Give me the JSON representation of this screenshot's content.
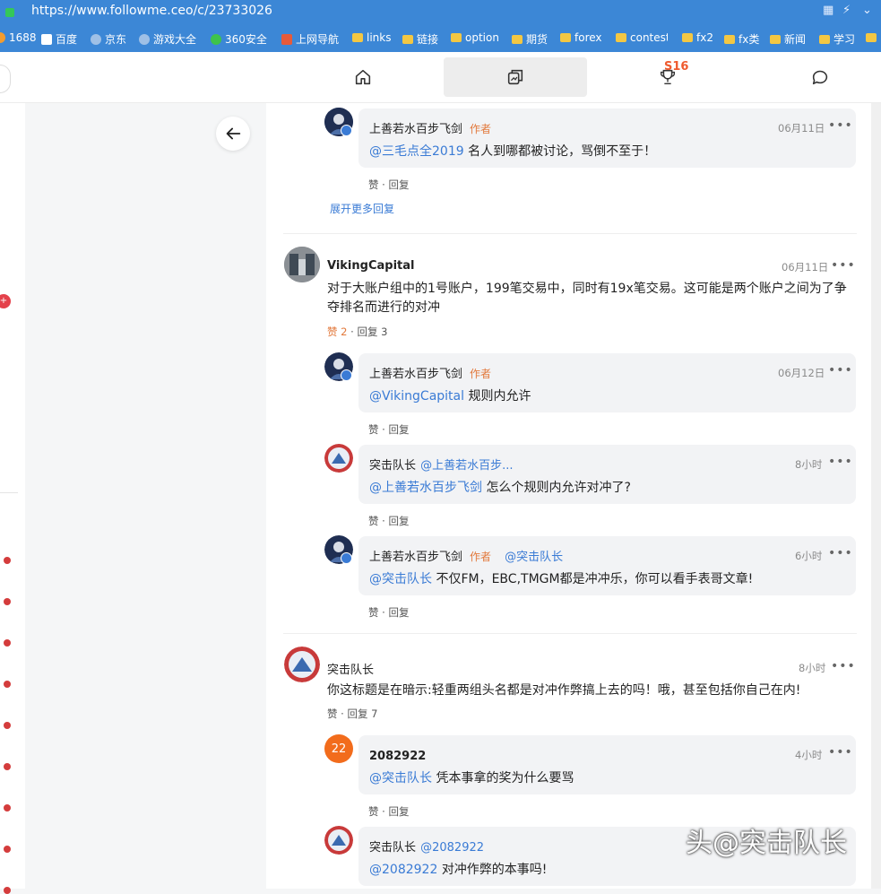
{
  "browser": {
    "url": "https://www.followme.ceo/c/23733026",
    "bookmarks": [
      "1688",
      "百度",
      "京东",
      "游戏大全",
      "360安全",
      "上网导航",
      "links",
      "链接",
      "option",
      "期货",
      "forex",
      "contest",
      "fx2",
      "fx类",
      "新闻",
      "学习"
    ]
  },
  "nav": {
    "home_icon": "home-icon",
    "copy_icon": "copy-trade-icon",
    "trophy_badge": "S16",
    "chat_icon": "chat-icon"
  },
  "colors": {
    "accent": "#3a7bd5",
    "author_tag": "#e2793c",
    "bubble_bg": "#f2f3f5"
  },
  "thread": {
    "top_reply": {
      "user": "上善若水百步飞剑",
      "tag": "作者",
      "time": "06月11日",
      "mention": "@三毛点全2019",
      "text": "名人到哪都被讨论，骂倒不至于！",
      "like": "赞",
      "reply": "回复"
    },
    "expand_more": "展开更多回复",
    "comments": [
      {
        "user": "VikingCapital",
        "time": "06月11日",
        "text": "对于大账户组中的1号账户，199笔交易中，同时有19x笔交易。这可能是两个账户之间为了争夺排名而进行的对冲",
        "like": "赞 2",
        "reply": "回复 3",
        "replies": [
          {
            "user": "上善若水百步飞剑",
            "tag": "作者",
            "time": "06月12日",
            "mention": "@VikingCapital",
            "text": "规则内允许",
            "like": "赞",
            "reply": "回复"
          },
          {
            "user": "突击队长",
            "reply_to": "@上善若水百步...",
            "time": "8小时",
            "mention": "@上善若水百步飞剑",
            "text": "怎么个规则内允许对冲了?",
            "like": "赞",
            "reply": "回复"
          },
          {
            "user": "上善若水百步飞剑",
            "tag": "作者",
            "reply_to": "@突击队长",
            "time": "6小时",
            "mention": "@突击队长",
            "text": "不仅FM，EBC,TMGM都是冲冲乐，你可以看手表哥文章!",
            "like": "赞",
            "reply": "回复"
          }
        ]
      },
      {
        "user": "突击队长",
        "time": "8小时",
        "text": "你这标题是在暗示:轻重两组头名都是对冲作弊搞上去的吗！哦，甚至包括你自己在内!",
        "like": "赞",
        "reply": "回复 7",
        "replies": [
          {
            "user": "2082922",
            "avatar_text": "22",
            "time": "4小时",
            "mention": "@突击队长",
            "text": "凭本事拿的奖为什么要骂",
            "like": "赞",
            "reply": "回复"
          },
          {
            "user": "突击队长",
            "reply_to": "@2082922",
            "mention": "@2082922",
            "text": "对冲作弊的本事吗!"
          }
        ]
      }
    ]
  },
  "more_label": "•••",
  "dot": "·",
  "watermark": "头@突击队长"
}
